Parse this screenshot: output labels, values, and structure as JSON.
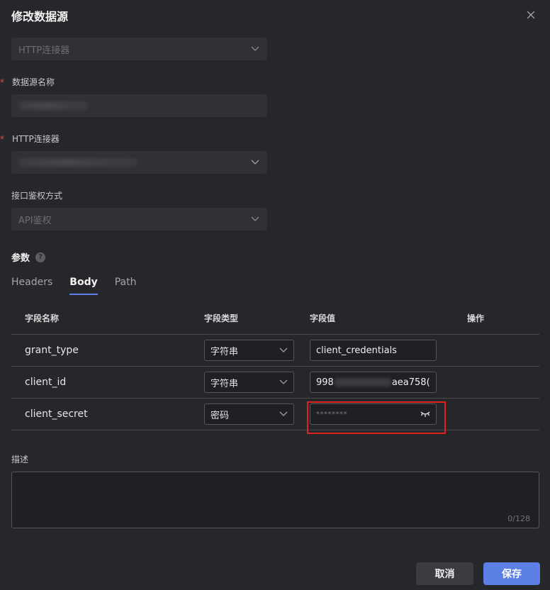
{
  "dialog": {
    "title": "修改数据源"
  },
  "connector_type": {
    "value": "HTTP连接器"
  },
  "datasource_name": {
    "label": "数据源名称",
    "required_mark": "*"
  },
  "http_connector": {
    "label": "HTTP连接器",
    "required_mark": "*"
  },
  "auth_method": {
    "label": "接口鉴权方式",
    "value": "API鉴权"
  },
  "params": {
    "title": "参数",
    "help_glyph": "?",
    "tabs": [
      {
        "label": "Headers",
        "active": false
      },
      {
        "label": "Body",
        "active": true
      },
      {
        "label": "Path",
        "active": false
      }
    ],
    "columns": {
      "name": "字段名称",
      "type": "字段类型",
      "value": "字段值",
      "action": "操作"
    },
    "rows": [
      {
        "name": "grant_type",
        "type": "字符串",
        "value": "client_credentials"
      },
      {
        "name": "client_id",
        "type": "字符串",
        "value_prefix": "998",
        "value_suffix": "aea758("
      },
      {
        "name": "client_secret",
        "type": "密码",
        "value_masked": "********"
      }
    ]
  },
  "description": {
    "label": "描述",
    "counter": "0/128"
  },
  "footer": {
    "cancel_label": "取消",
    "save_label": "保存"
  },
  "colors": {
    "accent": "#5b7fe5",
    "highlight_border": "#e0211e",
    "required": "#e04848"
  },
  "icons": [
    "close-icon",
    "chevron-down-icon",
    "help-icon",
    "eye-closed-icon"
  ]
}
